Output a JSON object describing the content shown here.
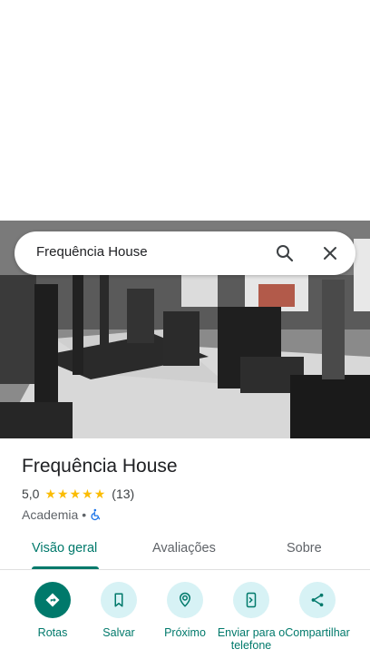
{
  "search": {
    "query": "Frequência House"
  },
  "place": {
    "name": "Frequência House",
    "rating": "5,0",
    "stars": 5,
    "review_count": "(13)",
    "category": "Academia",
    "separator": "•"
  },
  "tabs": [
    {
      "label": "Visão geral",
      "active": true
    },
    {
      "label": "Avaliações",
      "active": false
    },
    {
      "label": "Sobre",
      "active": false
    }
  ],
  "actions": [
    {
      "label": "Rotas",
      "icon": "directions-icon"
    },
    {
      "label": "Salvar",
      "icon": "bookmark-icon"
    },
    {
      "label": "Próximo",
      "icon": "nearby-icon"
    },
    {
      "label": "Enviar para o telefone",
      "icon": "send-to-phone-icon"
    },
    {
      "label": "Compartilhar",
      "icon": "share-icon"
    }
  ],
  "colors": {
    "accent": "#00796b",
    "star": "#fbbc04",
    "action_bg": "#d7f2f5"
  }
}
